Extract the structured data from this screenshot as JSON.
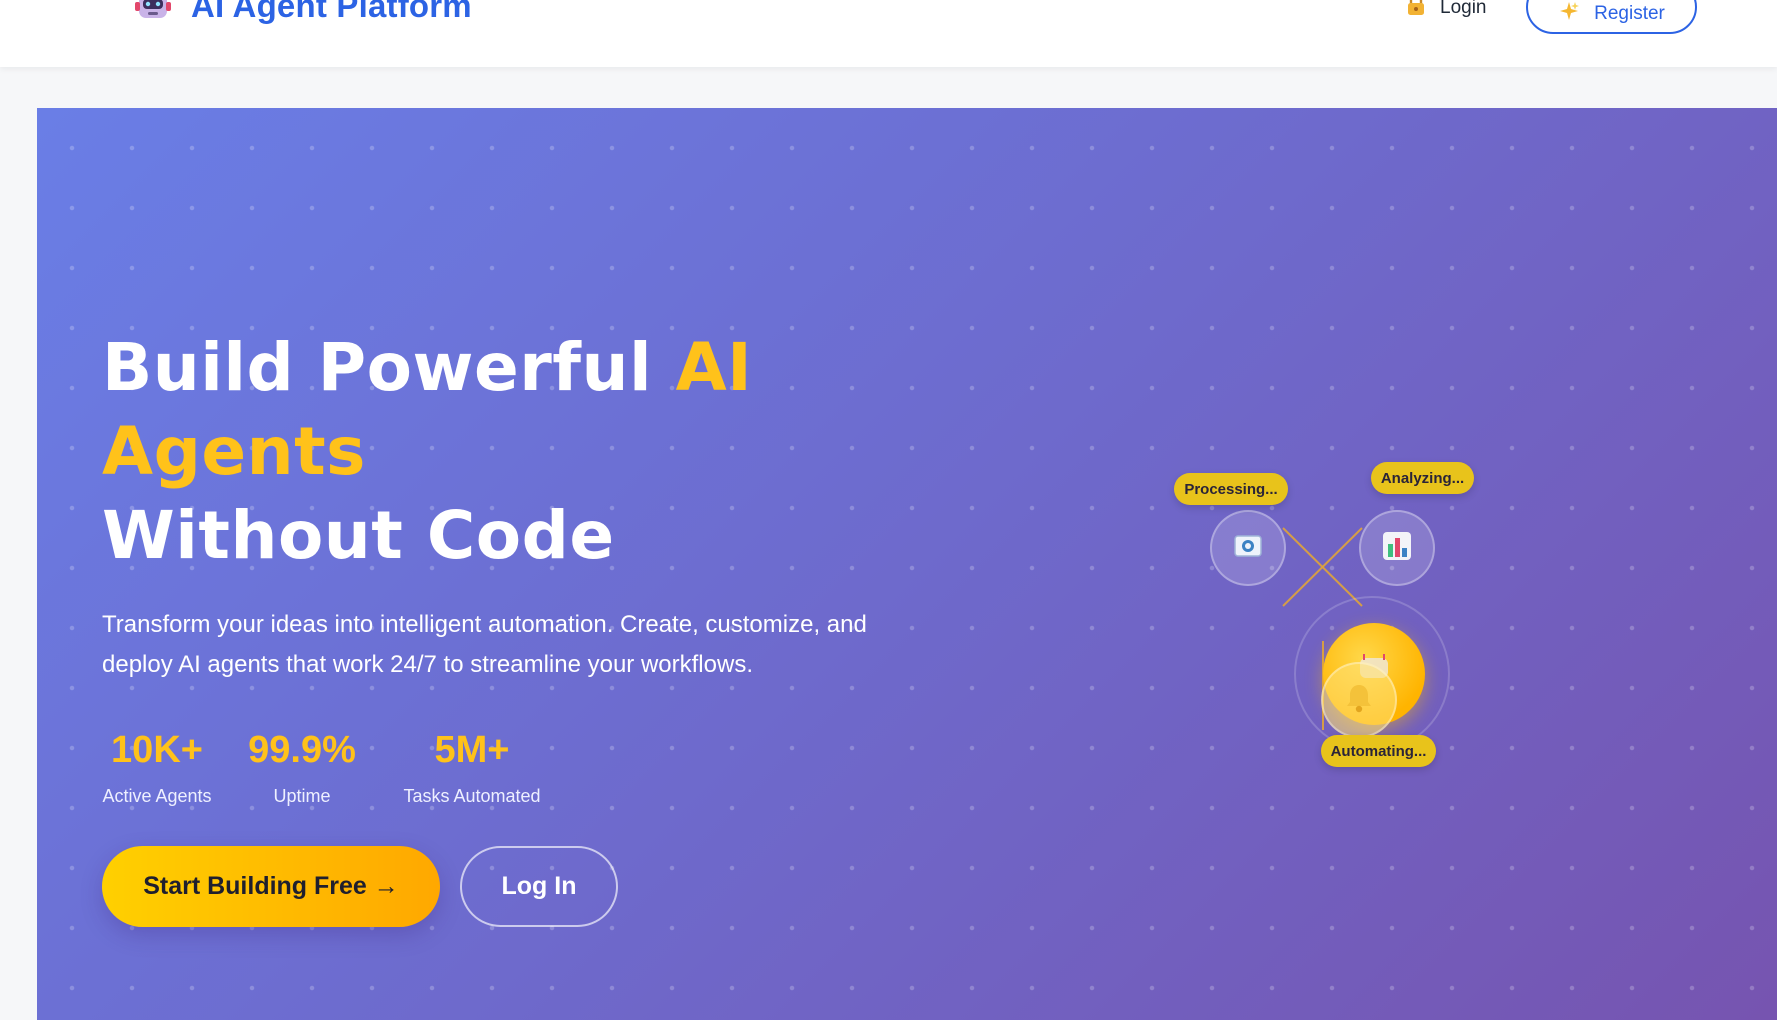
{
  "header": {
    "brand_icon": "robot-icon",
    "brand_name": "AI Agent Platform",
    "login_icon": "lock-icon",
    "login_label": "Login",
    "register_icon": "sparkles-icon",
    "register_label": "Register",
    "accent_color": "#2c63e4"
  },
  "hero": {
    "headline_line1": "Build Powerful ",
    "headline_highlight_1": "AI",
    "headline_highlight_2": "Agents",
    "headline_line3": "Without Code",
    "subtitle": "Transform your ideas into intelligent automation. Create, customize, and deploy AI agents that work 24/7 to streamline your workflows.",
    "stats": [
      {
        "value": "10K+",
        "label": "Active Agents"
      },
      {
        "value": "99.9%",
        "label": "Uptime"
      },
      {
        "value": "5M+",
        "label": "Tasks Automated"
      }
    ],
    "primary_button": "Start Building Free →",
    "secondary_button": "Log In",
    "highlight_color": "#ffc21a",
    "gradient_start": "#6a7ee6",
    "gradient_end": "#7654b0"
  },
  "illustration": {
    "tags": [
      "Processing...",
      "Analyzing...",
      "Automating..."
    ],
    "nodes": [
      "email-icon",
      "bar-chart-icon",
      "bell-icon"
    ]
  }
}
